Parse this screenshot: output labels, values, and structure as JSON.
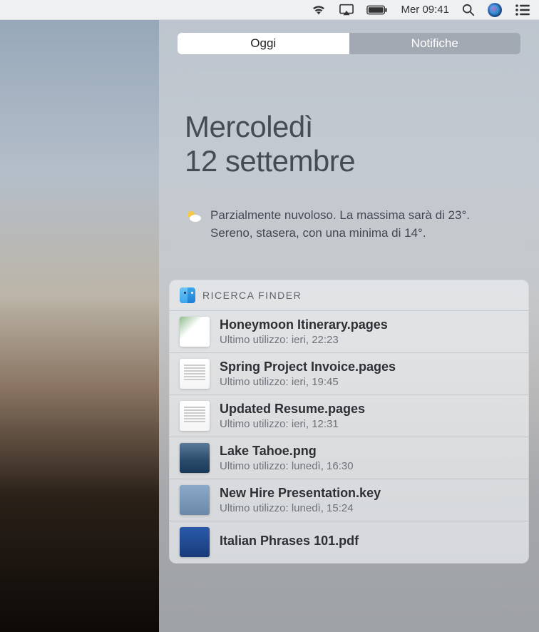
{
  "menubar": {
    "datetime": "Mer 09:41"
  },
  "tabs": {
    "today": "Oggi",
    "notifications": "Notifiche"
  },
  "date": {
    "dayname": "Mercoledì",
    "full": "12 settembre"
  },
  "weather": {
    "text": "Parzialmente nuvoloso. La massima sarà di 23°. Sereno, stasera, con una minima di 14°."
  },
  "finder_widget": {
    "title": "RICERCA FINDER",
    "files": [
      {
        "name": "Honeymoon Itinerary.pages",
        "meta": "Ultimo utilizzo: ieri, 22:23",
        "thumb": "pages1"
      },
      {
        "name": "Spring Project Invoice.pages",
        "meta": "Ultimo utilizzo: ieri, 19:45",
        "thumb": "doc"
      },
      {
        "name": "Updated Resume.pages",
        "meta": "Ultimo utilizzo: ieri, 12:31",
        "thumb": "doc"
      },
      {
        "name": "Lake Tahoe.png",
        "meta": "Ultimo utilizzo: lunedì, 16:30",
        "thumb": "photo"
      },
      {
        "name": "New Hire Presentation.key",
        "meta": "Ultimo utilizzo: lunedì, 15:24",
        "thumb": "key"
      },
      {
        "name": "Italian Phrases 101.pdf",
        "meta": "",
        "thumb": "pdf"
      }
    ]
  }
}
